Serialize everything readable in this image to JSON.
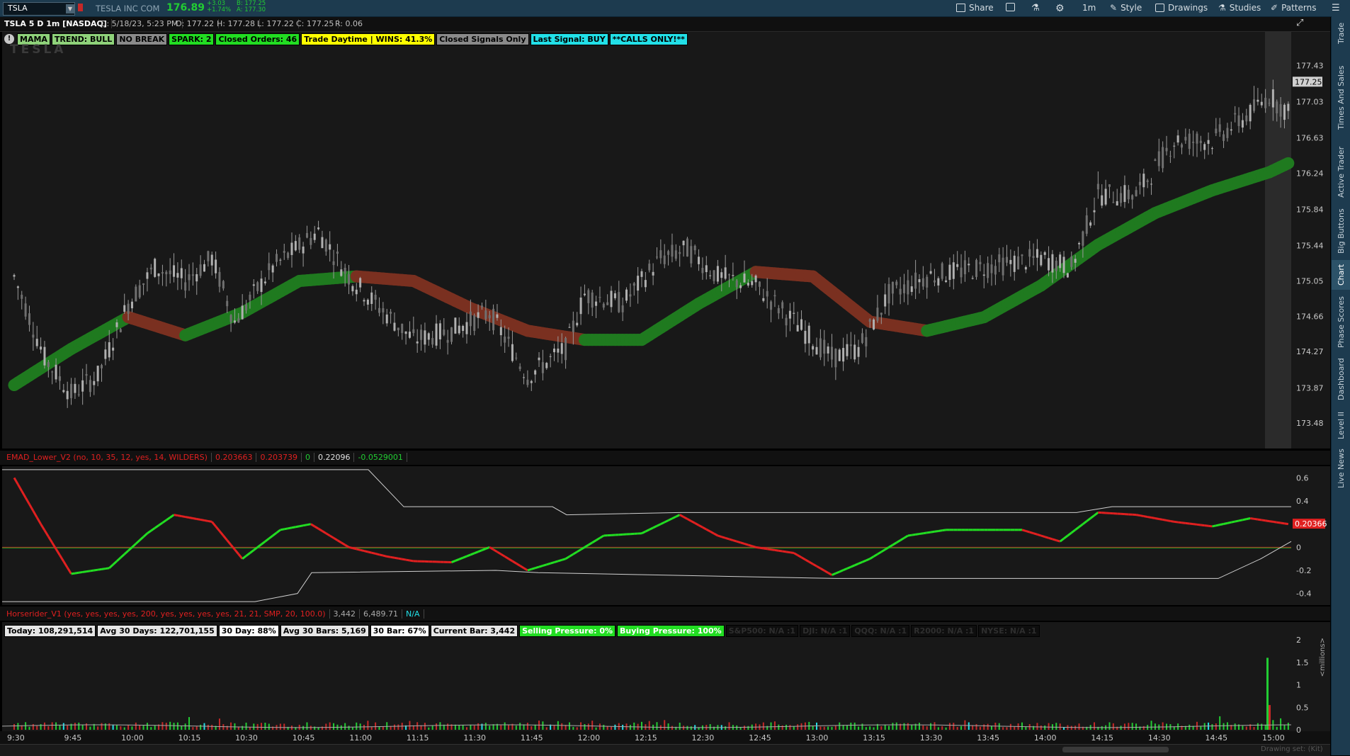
{
  "toolbar": {
    "symbol": "TSLA",
    "company": "TESLA INC COM",
    "last_price": "176.89",
    "change": "+3.03",
    "change_pct": "+1.74%",
    "bid": "B: 177.25",
    "ask": "A: 177.30",
    "share": "Share",
    "timeframe": "1m",
    "style": "Style",
    "drawings": "Drawings",
    "studies": "Studies",
    "patterns": "Patterns"
  },
  "sidebar": [
    "Trade",
    "Times And Sales",
    "Active Trader",
    "Big Buttons",
    "Chart",
    "Phase Scores",
    "Dashboard",
    "Level II",
    "Live News"
  ],
  "titlebar": {
    "name": "TSLA 5 D 1m [NASDAQ]",
    "date": "D: 5/18/23, 5:23 PM",
    "open": "O: 177.22",
    "high": "H: 177.28",
    "low": "L: 177.22",
    "close": "C: 177.25",
    "range": "R: 0.06"
  },
  "upper_labels": [
    {
      "text": "MAMA",
      "bg": "#8fd27a",
      "fg": "#000"
    },
    {
      "text": "TREND: BULL",
      "bg": "#8fd27a",
      "fg": "#000"
    },
    {
      "text": "NO BREAK",
      "bg": "#8a8a8a",
      "fg": "#000"
    },
    {
      "text": "SPARK: 2",
      "bg": "#22dd22",
      "fg": "#000"
    },
    {
      "text": "Closed Orders: 46",
      "bg": "#22dd22",
      "fg": "#000"
    },
    {
      "text": "Trade Daytime | WINS: 41.3%",
      "bg": "#ffff00",
      "fg": "#000"
    },
    {
      "text": "Closed Signals Only",
      "bg": "#8a8a8a",
      "fg": "#000"
    },
    {
      "text": "Last Signal: BUY",
      "bg": "#22e0e8",
      "fg": "#000"
    },
    {
      "text": "**CALLS ONLY!**",
      "bg": "#22e0e8",
      "fg": "#000"
    }
  ],
  "watermark": "TESLA",
  "price_axis": [
    "177.43",
    "177.03",
    "176.63",
    "176.24",
    "175.84",
    "175.44",
    "175.05",
    "174.66",
    "174.27",
    "173.87",
    "173.48"
  ],
  "price_marker": "177.25",
  "emad_header": [
    {
      "text": "EMAD_Lower_V2 (no, 10, 35, 12, yes, 14, WILDERS)",
      "color": "#e02020"
    },
    {
      "text": "0.203663",
      "color": "#e02020"
    },
    {
      "text": "0.203739",
      "color": "#e02020"
    },
    {
      "text": "0",
      "color": "#22cc33"
    },
    {
      "text": "0.22096",
      "color": "#e0e0e0"
    },
    {
      "text": "-0.0529001",
      "color": "#22cc33"
    }
  ],
  "emad_axis": [
    "0.6",
    "0.4",
    "0.2",
    "0",
    "-0.2",
    "-0.4"
  ],
  "emad_marker": "0.20366",
  "horse_header": [
    {
      "text": "Horserider_V1 (yes, yes, yes, yes, 200, yes, yes, yes, yes, 21, 21, SMP, 20, 100.0)",
      "color": "#e02020"
    },
    {
      "text": "3,442",
      "color": "#aaaaaa"
    },
    {
      "text": "6,489.71",
      "color": "#aaaaaa"
    },
    {
      "text": "N/A",
      "color": "#22e0e8"
    }
  ],
  "volume_labels": [
    {
      "text": "Today: 108,291,514",
      "bg": "#e6e6e6",
      "fg": "#000"
    },
    {
      "text": "Avg 30 Days: 122,701,155",
      "bg": "#e6e6e6",
      "fg": "#000"
    },
    {
      "text": "30 Day: 88%",
      "bg": "#ffffff",
      "fg": "#000"
    },
    {
      "text": "Avg 30 Bars: 5,169",
      "bg": "#e6e6e6",
      "fg": "#000"
    },
    {
      "text": "30 Bar: 67%",
      "bg": "#ffffff",
      "fg": "#000"
    },
    {
      "text": "Current Bar: 3,442",
      "bg": "#e6e6e6",
      "fg": "#000"
    },
    {
      "text": "Selling Pressure: 0%",
      "bg": "#22dd22",
      "fg": "#fff"
    },
    {
      "text": "Buying Pressure: 100%",
      "bg": "#22dd22",
      "fg": "#fff"
    },
    {
      "text": "S&P500: N/A :1",
      "bg": "#0e0e0e",
      "fg": "#2e2e2e"
    },
    {
      "text": "DJI: N/A :1",
      "bg": "#0e0e0e",
      "fg": "#2e2e2e"
    },
    {
      "text": "QQQ: N/A :1",
      "bg": "#0e0e0e",
      "fg": "#2e2e2e"
    },
    {
      "text": "R2000: N/A :1",
      "bg": "#0e0e0e",
      "fg": "#2e2e2e"
    },
    {
      "text": "NYSE: N/A :1",
      "bg": "#0e0e0e",
      "fg": "#2e2e2e"
    }
  ],
  "volume_axis": [
    "2",
    "1.5",
    "1",
    "0.5",
    "0"
  ],
  "volume_unit": "<millions>",
  "time_axis": [
    "9:30",
    "9:45",
    "10:00",
    "10:15",
    "10:30",
    "10:45",
    "11:00",
    "11:15",
    "11:30",
    "11:45",
    "12:00",
    "12:15",
    "12:30",
    "12:45",
    "13:00",
    "13:15",
    "13:30",
    "13:45",
    "14:00",
    "14:15",
    "14:30",
    "14:45",
    "15:00"
  ],
  "drawing_set": "Drawing set: (Kit)",
  "chart_data": [
    {
      "type": "candlestick",
      "title": "TSLA 5 D 1m [NASDAQ]",
      "ylim": [
        173.2,
        177.8
      ],
      "approx_close_path": [
        {
          "x": "9:30",
          "y": 175.1
        },
        {
          "x": "9:38",
          "y": 174.2
        },
        {
          "x": "9:45",
          "y": 173.8
        },
        {
          "x": "9:52",
          "y": 174.0
        },
        {
          "x": "10:00",
          "y": 174.8
        },
        {
          "x": "10:07",
          "y": 175.2
        },
        {
          "x": "10:15",
          "y": 175.05
        },
        {
          "x": "10:22",
          "y": 175.3
        },
        {
          "x": "10:28",
          "y": 174.6
        },
        {
          "x": "10:38",
          "y": 175.2
        },
        {
          "x": "10:50",
          "y": 175.6
        },
        {
          "x": "10:58",
          "y": 175.1
        },
        {
          "x": "11:05",
          "y": 174.8
        },
        {
          "x": "11:15",
          "y": 174.4
        },
        {
          "x": "11:25",
          "y": 174.5
        },
        {
          "x": "11:35",
          "y": 174.7
        },
        {
          "x": "11:45",
          "y": 174.0
        },
        {
          "x": "11:55",
          "y": 174.3
        },
        {
          "x": "12:00",
          "y": 174.9
        },
        {
          "x": "12:10",
          "y": 174.8
        },
        {
          "x": "12:20",
          "y": 175.3
        },
        {
          "x": "12:27",
          "y": 175.4
        },
        {
          "x": "12:35",
          "y": 175.1
        },
        {
          "x": "12:45",
          "y": 175.0
        },
        {
          "x": "12:55",
          "y": 174.6
        },
        {
          "x": "13:05",
          "y": 174.2
        },
        {
          "x": "13:12",
          "y": 174.3
        },
        {
          "x": "13:20",
          "y": 174.9
        },
        {
          "x": "13:30",
          "y": 175.1
        },
        {
          "x": "13:45",
          "y": 175.2
        },
        {
          "x": "14:00",
          "y": 175.3
        },
        {
          "x": "14:08",
          "y": 175.2
        },
        {
          "x": "14:15",
          "y": 176.0
        },
        {
          "x": "14:25",
          "y": 176.0
        },
        {
          "x": "14:35",
          "y": 176.6
        },
        {
          "x": "14:45",
          "y": 176.6
        },
        {
          "x": "14:55",
          "y": 176.9
        },
        {
          "x": "15:00",
          "y": 177.1
        },
        {
          "x": "15:05",
          "y": 176.9
        }
      ],
      "moving_average_band": [
        {
          "x": "9:30",
          "y": 173.9
        },
        {
          "x": "9:45",
          "y": 174.3
        },
        {
          "x": "10:00",
          "y": 174.65
        },
        {
          "x": "10:15",
          "y": 174.45
        },
        {
          "x": "10:30",
          "y": 174.7
        },
        {
          "x": "10:45",
          "y": 175.05
        },
        {
          "x": "11:00",
          "y": 175.1
        },
        {
          "x": "11:15",
          "y": 175.05
        },
        {
          "x": "11:30",
          "y": 174.75
        },
        {
          "x": "11:45",
          "y": 174.5
        },
        {
          "x": "12:00",
          "y": 174.4
        },
        {
          "x": "12:15",
          "y": 174.4
        },
        {
          "x": "12:30",
          "y": 174.8
        },
        {
          "x": "12:45",
          "y": 175.15
        },
        {
          "x": "13:00",
          "y": 175.1
        },
        {
          "x": "13:15",
          "y": 174.6
        },
        {
          "x": "13:30",
          "y": 174.5
        },
        {
          "x": "13:45",
          "y": 174.65
        },
        {
          "x": "14:00",
          "y": 175.0
        },
        {
          "x": "14:15",
          "y": 175.45
        },
        {
          "x": "14:30",
          "y": 175.8
        },
        {
          "x": "14:45",
          "y": 176.05
        },
        {
          "x": "15:00",
          "y": 176.25
        },
        {
          "x": "15:05",
          "y": 176.35
        }
      ]
    },
    {
      "type": "line",
      "title": "EMAD_Lower_V2 (no, 10, 35, 12, yes, 14, WILDERS)",
      "ylim": [
        -0.5,
        0.7
      ],
      "series": [
        {
          "name": "",
          "x": [
            "9:30",
            "9:37",
            "9:45",
            "9:55",
            "10:05",
            "10:12",
            "10:22",
            "10:30",
            "10:40",
            "10:48",
            "10:58",
            "11:08",
            "11:15",
            "11:25",
            "11:35",
            "11:45",
            "11:55",
            "12:05",
            "12:15",
            "12:25",
            "12:35",
            "12:45",
            "12:55",
            "13:05",
            "13:15",
            "13:25",
            "13:35",
            "13:45",
            "13:55",
            "14:05",
            "14:15",
            "14:25",
            "14:35",
            "14:45",
            "14:55",
            "15:05"
          ],
          "values": [
            0.6,
            0.2,
            -0.23,
            -0.18,
            0.12,
            0.28,
            0.22,
            -0.1,
            0.15,
            0.2,
            0.0,
            -0.08,
            -0.12,
            -0.13,
            0.0,
            -0.2,
            -0.1,
            0.1,
            0.12,
            0.28,
            0.1,
            0.0,
            -0.05,
            -0.24,
            -0.1,
            0.1,
            0.15,
            0.15,
            0.15,
            0.05,
            0.3,
            0.28,
            0.22,
            0.18,
            0.25,
            0.2
          ]
        }
      ]
    },
    {
      "type": "bar",
      "title": "Horserider_V1",
      "ylabel": "<millions>",
      "ylim": [
        0,
        2
      ],
      "notable_values": [
        {
          "x": "15:00",
          "value": 1.6
        },
        {
          "x": "15:00",
          "value": 0.55
        }
      ]
    }
  ]
}
